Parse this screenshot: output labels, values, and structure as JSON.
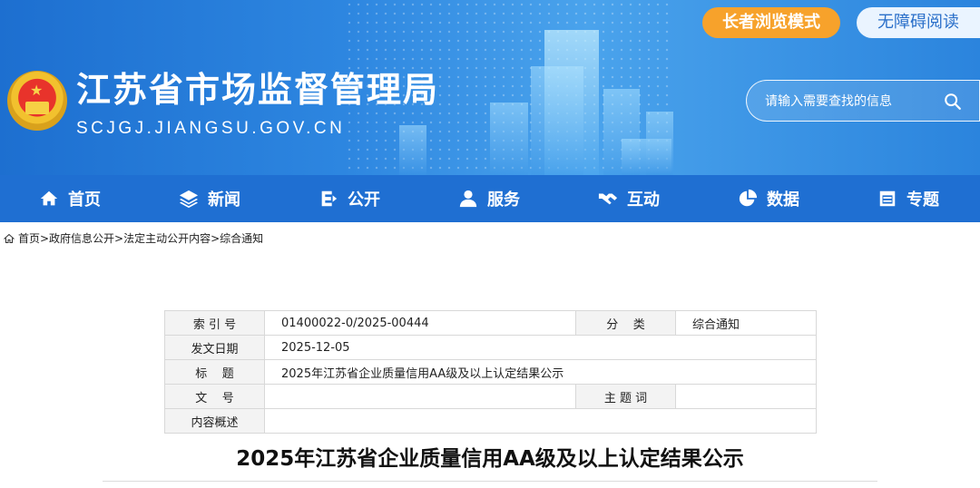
{
  "header": {
    "site_title": "江苏省市场监督管理局",
    "site_domain": "SCJGJ.JIANGSU.GOV.CN",
    "elder_mode_label": "长者浏览模式",
    "accessibility_label": "无障碍阅读",
    "search_placeholder": "请输入需要查找的信息"
  },
  "nav": {
    "items": [
      {
        "label": "首页",
        "icon": "home-icon"
      },
      {
        "label": "新闻",
        "icon": "layers-icon"
      },
      {
        "label": "公开",
        "icon": "open-icon"
      },
      {
        "label": "服务",
        "icon": "user-icon"
      },
      {
        "label": "互动",
        "icon": "handshake-icon"
      },
      {
        "label": "数据",
        "icon": "pie-chart-icon"
      },
      {
        "label": "专题",
        "icon": "window-icon"
      }
    ]
  },
  "breadcrumb": {
    "text": "首页>政府信息公开>法定主动公开内容>综合通知"
  },
  "meta": {
    "index_label": "索 引 号",
    "index_value": "01400022-0/2025-00444",
    "category_label": "分    类",
    "category_value": "综合通知",
    "date_label": "发文日期",
    "date_value": "2025-12-05",
    "title_label": "标    题",
    "title_value": "2025年江苏省企业质量信用AA级及以上认定结果公示",
    "docno_label": "文    号",
    "docno_value": "",
    "subject_label": "主 题 词",
    "subject_value": "",
    "summary_label": "内容概述",
    "summary_value": ""
  },
  "article": {
    "title": "2025年江苏省企业质量信用AA级及以上认定结果公示"
  },
  "colors": {
    "header_blue": "#2d86e0",
    "nav_blue": "#1f6fd2",
    "elder_orange": "#f7a22b"
  }
}
